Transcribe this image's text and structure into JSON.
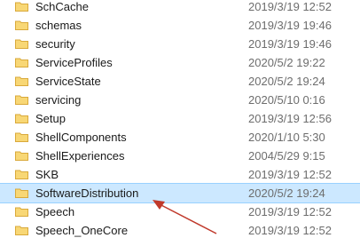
{
  "rows": [
    {
      "name": "SchCache",
      "modified": "2019/3/19 12:52"
    },
    {
      "name": "schemas",
      "modified": "2019/3/19 19:46"
    },
    {
      "name": "security",
      "modified": "2019/3/19 19:46"
    },
    {
      "name": "ServiceProfiles",
      "modified": "2020/5/2 19:22"
    },
    {
      "name": "ServiceState",
      "modified": "2020/5/2 19:24"
    },
    {
      "name": "servicing",
      "modified": "2020/5/10 0:16"
    },
    {
      "name": "Setup",
      "modified": "2019/3/19 12:56"
    },
    {
      "name": "ShellComponents",
      "modified": "2020/1/10 5:30"
    },
    {
      "name": "ShellExperiences",
      "modified": "2004/5/29 9:15"
    },
    {
      "name": "SKB",
      "modified": "2019/3/19 12:52"
    },
    {
      "name": "SoftwareDistribution",
      "modified": "2020/5/2 19:24"
    },
    {
      "name": "Speech",
      "modified": "2019/3/19 12:52"
    },
    {
      "name": "Speech_OneCore",
      "modified": "2019/3/19 12:52"
    }
  ],
  "selected_row": "SoftwareDistribution",
  "colors": {
    "selection_bg": "#cce8ff",
    "selection_border": "#99d1ff",
    "folder_fill": "#f8d775",
    "folder_tab": "#e8b84a",
    "arrow": "#c0392b"
  },
  "icons": {
    "folder": "folder-icon",
    "annotation": "red-arrow-icon"
  }
}
